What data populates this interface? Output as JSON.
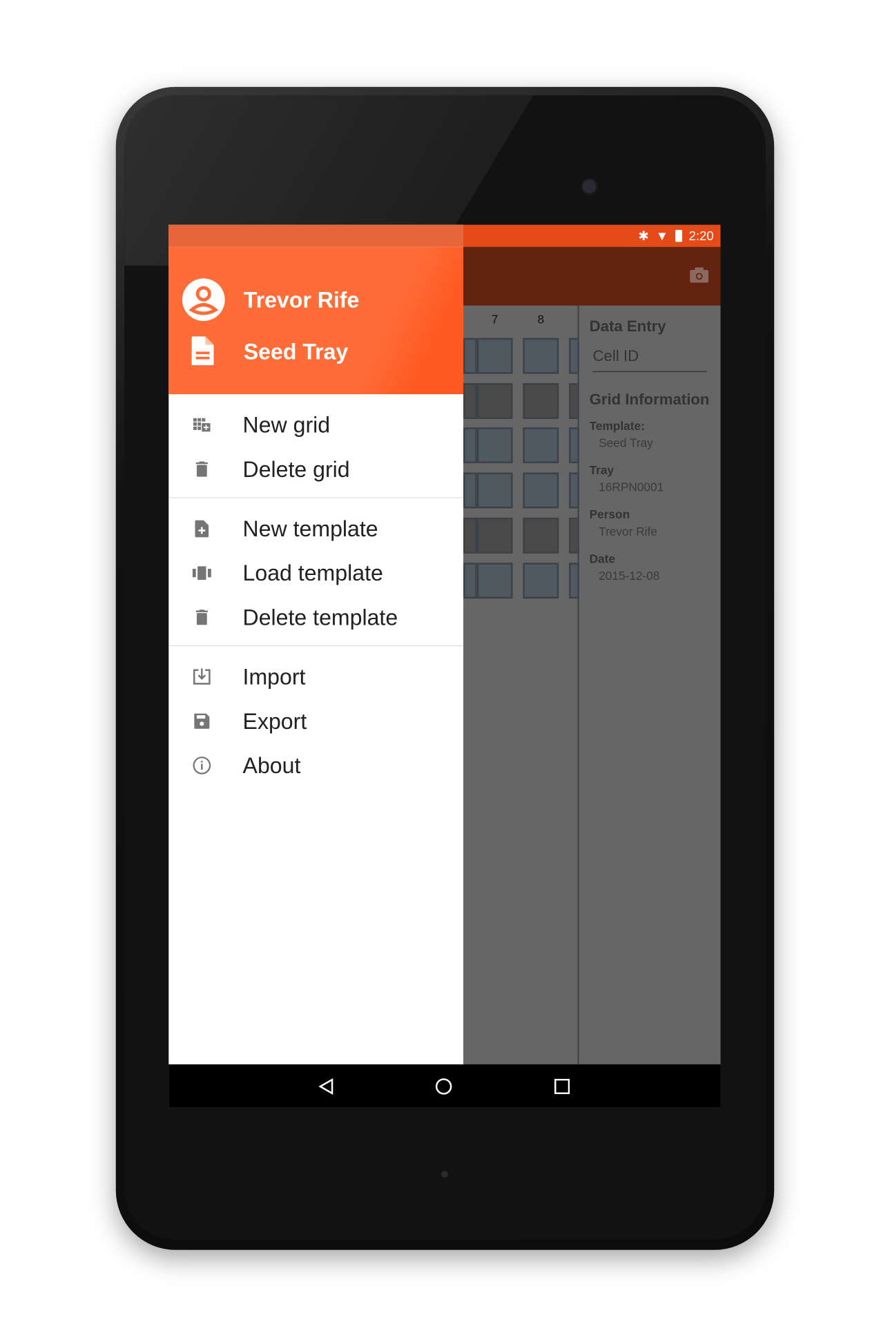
{
  "status_bar": {
    "time": "2:20",
    "icons": [
      "bluetooth-icon",
      "wifi-icon",
      "battery-icon"
    ]
  },
  "toolbar": {
    "action_icon": "camera-icon"
  },
  "grid": {
    "column_labels": [
      "7",
      "8"
    ],
    "row_colors": [
      "#4f5962",
      "#4a4a4a",
      "#4f5962",
      "#4f5962",
      "#4a4a4a",
      "#4f5962"
    ]
  },
  "panel": {
    "data_entry_title": "Data Entry",
    "cell_id_placeholder": "Cell ID",
    "grid_info_title": "Grid Information",
    "fields": [
      {
        "label": "Template:",
        "value": "Seed Tray"
      },
      {
        "label": "Tray",
        "value": "16RPN0001"
      },
      {
        "label": "Person",
        "value": "Trevor Rife"
      },
      {
        "label": "Date",
        "value": "2015-12-08"
      }
    ]
  },
  "drawer": {
    "user_name": "Trevor Rife",
    "template_name": "Seed Tray",
    "menu": [
      {
        "label": "New grid",
        "icon": "grid-add-icon"
      },
      {
        "label": "Delete grid",
        "icon": "trash-icon"
      },
      {
        "label": "New template",
        "icon": "file-add-icon"
      },
      {
        "label": "Load template",
        "icon": "carousel-icon"
      },
      {
        "label": "Delete template",
        "icon": "trash-icon"
      },
      {
        "label": "Import",
        "icon": "import-icon"
      },
      {
        "label": "Export",
        "icon": "save-icon"
      },
      {
        "label": "About",
        "icon": "info-icon"
      }
    ]
  },
  "colors": {
    "accent": "#ff6c37",
    "status_bar": "#e64a19",
    "toolbar": "#63230f"
  }
}
